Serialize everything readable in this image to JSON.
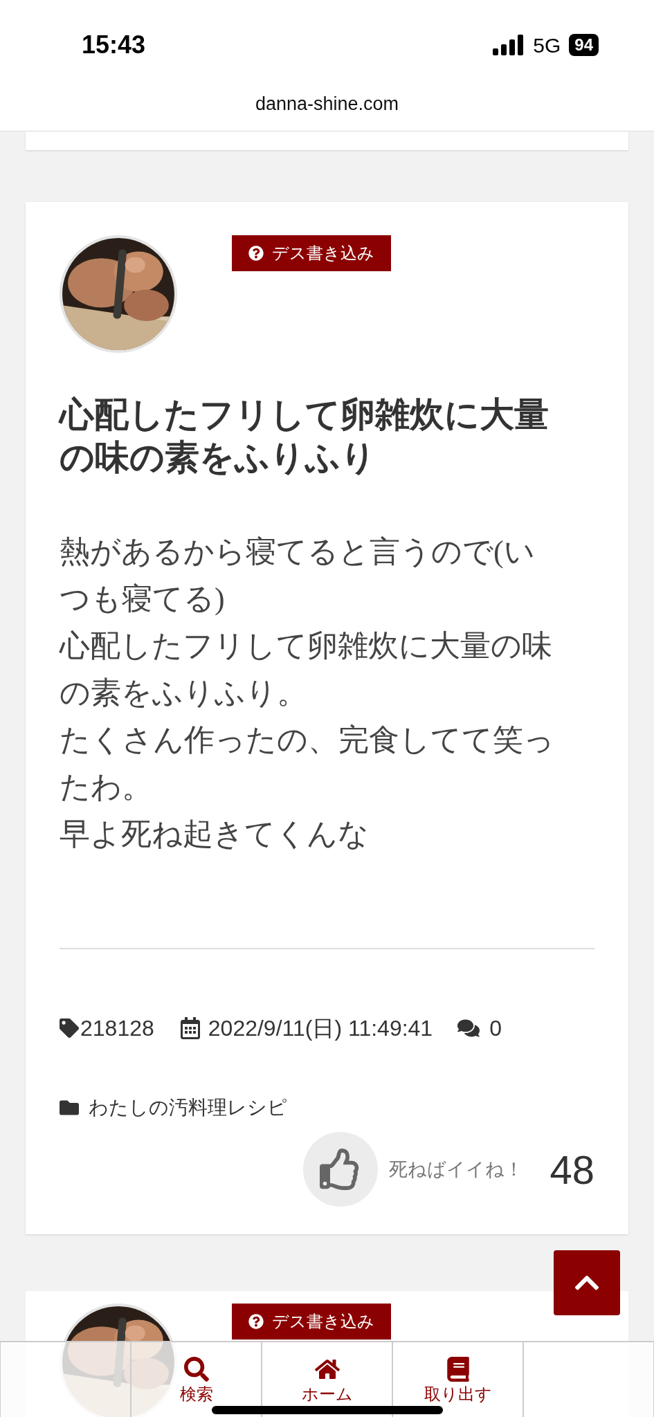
{
  "status_bar": {
    "time": "15:43",
    "network": "5G",
    "battery": "94"
  },
  "address_bar": {
    "url": "danna-shine.com"
  },
  "post": {
    "category_badge": "デス書き込み",
    "title": "心配したフリして卵雑炊に大量の味の素をふりふり",
    "body": [
      "熱があるから寝てると言うので(いつも寝てる)",
      "心配したフリして卵雑炊に大量の味の素をふりふり。",
      "たくさん作ったの、完食してて笑ったわ。",
      "早よ死ね起きてくんな"
    ],
    "post_id": "218128",
    "date": "2022/9/11(日) 11:49:41",
    "comments": "0",
    "category": "わたしの汚料理レシピ",
    "like_label": "死ねばイイね！",
    "like_count": "48"
  },
  "next_post": {
    "category_badge": "デス書き込み"
  },
  "bottom_nav": [
    {
      "kind": "empty"
    },
    {
      "kind": "search",
      "label": "検索"
    },
    {
      "kind": "home",
      "label": "ホーム"
    },
    {
      "kind": "book",
      "label": "取り出す"
    },
    {
      "kind": "empty"
    }
  ]
}
